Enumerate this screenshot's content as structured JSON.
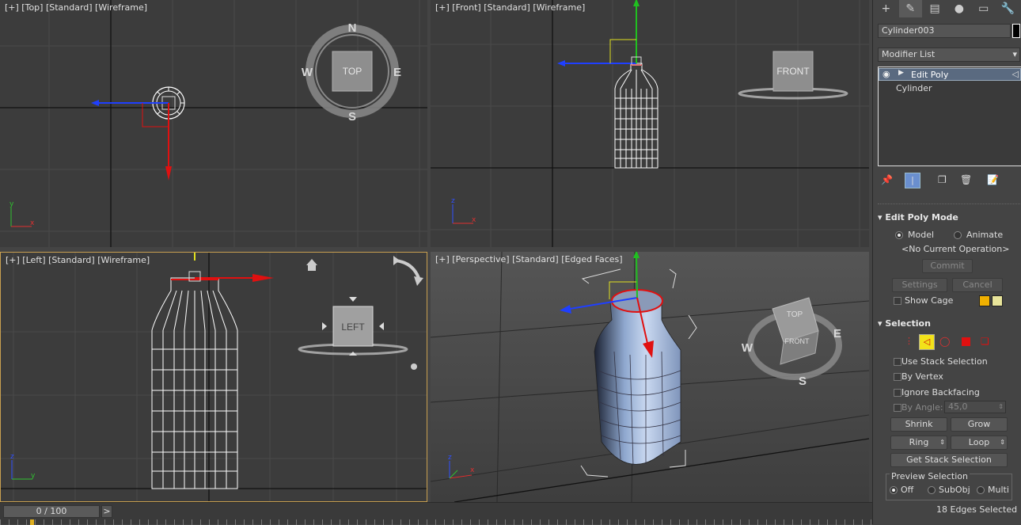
{
  "viewports": {
    "top": {
      "label": "[+] [Top] [Standard] [Wireframe]",
      "cube": "TOP",
      "compass": {
        "n": "N",
        "s": "S",
        "e": "E",
        "w": "W"
      }
    },
    "front": {
      "label": "[+] [Front] [Standard] [Wireframe]",
      "cube": "FRONT"
    },
    "left": {
      "label": "[+] [Left] [Standard] [Wireframe]",
      "cube": "LEFT"
    },
    "perspective": {
      "label": "[+] [Perspective] [Standard] [Edged Faces]",
      "cube_top": "TOP",
      "cube_front": "FRONT",
      "compass": {
        "s": "S",
        "e": "E",
        "w": "W"
      }
    }
  },
  "axis": {
    "x": "x",
    "y": "y",
    "z": "z"
  },
  "panel": {
    "object_name": "Cylinder003",
    "modifier_list": "Modifier List",
    "stack": [
      "Edit Poly",
      "Cylinder"
    ],
    "edit_poly_mode": {
      "title": "Edit Poly Mode",
      "model": "Model",
      "animate": "Animate",
      "operation": "<No Current Operation>",
      "commit": "Commit",
      "settings": "Settings",
      "cancel": "Cancel",
      "show_cage": "Show Cage",
      "cage_color_1": "#f0b000",
      "cage_color_2": "#e8e49a"
    },
    "selection": {
      "title": "Selection",
      "use_stack": "Use Stack Selection",
      "by_vertex": "By Vertex",
      "ignore_backfacing": "Ignore Backfacing",
      "by_angle": "By Angle:",
      "angle_value": "45,0",
      "shrink": "Shrink",
      "grow": "Grow",
      "ring": "Ring",
      "loop": "Loop",
      "get_stack": "Get Stack Selection",
      "preview": "Preview Selection",
      "off": "Off",
      "subobj": "SubObj",
      "multi": "Multi",
      "status": "18 Edges Selected"
    }
  },
  "timeline": {
    "frame": "0 / 100",
    "next": ">"
  }
}
